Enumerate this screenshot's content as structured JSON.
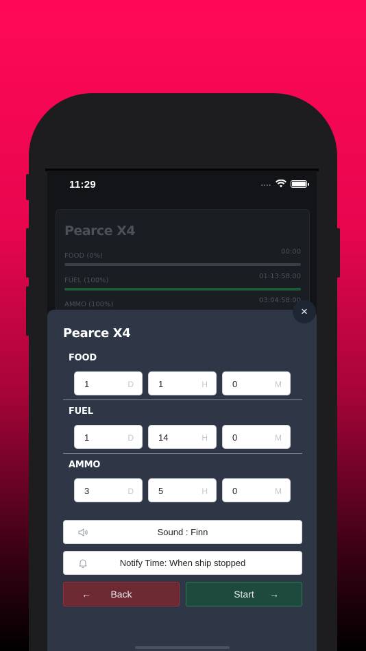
{
  "status_bar": {
    "time": "11:29",
    "signal": "....",
    "icons": [
      "wifi-icon",
      "battery-icon"
    ]
  },
  "background_card": {
    "title": "Pearce X4",
    "rows": [
      {
        "label": "FOOD (0%)",
        "value": "00:00",
        "progress": 0
      },
      {
        "label": "FUEL (100%)",
        "value": "01:13:58:00",
        "progress": 100
      },
      {
        "label": "AMMO (100%)",
        "value": "03:04:58:00",
        "progress": 100
      }
    ]
  },
  "modal": {
    "close_label": "×",
    "title": "Pearce X4",
    "sections": [
      {
        "label": "FOOD",
        "fields": [
          {
            "value": "1",
            "unit": "D"
          },
          {
            "value": "1",
            "unit": "H"
          },
          {
            "value": "0",
            "unit": "M"
          }
        ]
      },
      {
        "label": "FUEL",
        "fields": [
          {
            "value": "1",
            "unit": "D"
          },
          {
            "value": "14",
            "unit": "H"
          },
          {
            "value": "0",
            "unit": "M"
          }
        ]
      },
      {
        "label": "AMMO",
        "fields": [
          {
            "value": "3",
            "unit": "D"
          },
          {
            "value": "5",
            "unit": "H"
          },
          {
            "value": "0",
            "unit": "M"
          }
        ]
      }
    ],
    "sound_label": "Sound : Finn",
    "notify_label": "Notify Time: When ship stopped",
    "back_label": "Back",
    "start_label": "Start",
    "back_arrow": "←",
    "start_arrow": "→"
  },
  "colors": {
    "background_top": "#ff0857",
    "modal": "#2f3747",
    "back_button": "#6e2a33",
    "start_button": "#1d4a3c"
  }
}
